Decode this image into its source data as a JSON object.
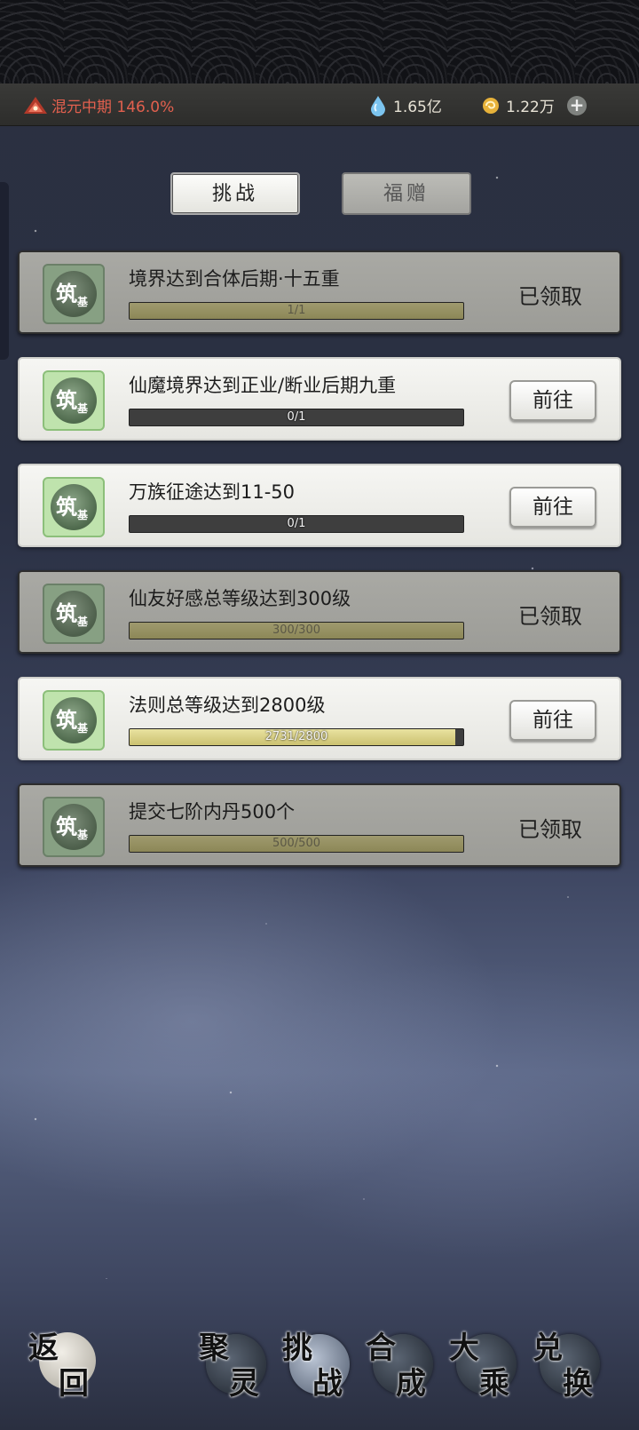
{
  "status": {
    "realm_text": "混元中期 146.0%",
    "resource1": "1.65亿",
    "resource2": "1.22万",
    "plus_label": "+",
    "realm_color": "#e2604e"
  },
  "tabs": [
    {
      "label": "挑战",
      "active": true
    },
    {
      "label": "福赠",
      "active": false
    }
  ],
  "tasks": [
    {
      "icon_main": "筑",
      "icon_sub": "基",
      "title": "境界达到合体后期·十五重",
      "progress_text": "1/1",
      "progress": 1.0,
      "state": "claimed",
      "action": "已领取"
    },
    {
      "icon_main": "筑",
      "icon_sub": "基",
      "title": "仙魔境界达到正业/断业后期九重",
      "progress_text": "0/1",
      "progress": 0.0,
      "state": "todo",
      "action": "前往"
    },
    {
      "icon_main": "筑",
      "icon_sub": "基",
      "title": "万族征途达到11-50",
      "progress_text": "0/1",
      "progress": 0.0,
      "state": "todo",
      "action": "前往"
    },
    {
      "icon_main": "筑",
      "icon_sub": "基",
      "title": "仙友好感总等级达到300级",
      "progress_text": "300/300",
      "progress": 1.0,
      "state": "claimed",
      "action": "已领取"
    },
    {
      "icon_main": "筑",
      "icon_sub": "基",
      "title": "法则总等级达到2800级",
      "progress_text": "2731/2800",
      "progress": 0.975,
      "state": "todo",
      "action": "前往"
    },
    {
      "icon_main": "筑",
      "icon_sub": "基",
      "title": "提交七阶内丹500个",
      "progress_text": "500/500",
      "progress": 1.0,
      "state": "claimed",
      "action": "已领取"
    }
  ],
  "nav": {
    "back": {
      "a": "返",
      "b": "回"
    },
    "items": [
      {
        "a": "聚",
        "b": "灵",
        "active": false
      },
      {
        "a": "挑",
        "b": "战",
        "active": true
      },
      {
        "a": "合",
        "b": "成",
        "active": false
      },
      {
        "a": "大",
        "b": "乘",
        "active": false
      },
      {
        "a": "兑",
        "b": "换",
        "active": false
      }
    ]
  }
}
